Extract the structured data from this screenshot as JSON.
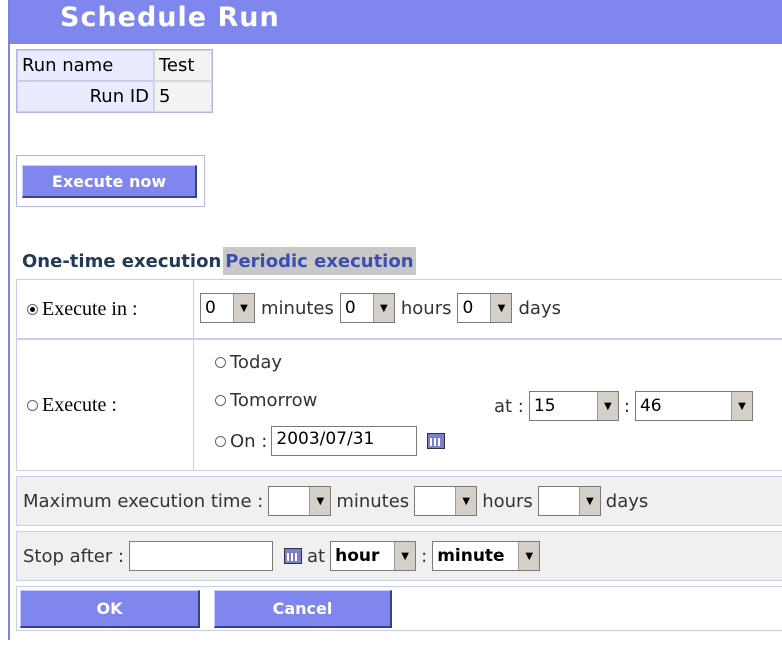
{
  "title": "Schedule Run",
  "run_info": [
    {
      "label": "Run name",
      "value": "Test"
    },
    {
      "label": "Run ID",
      "value": "5"
    }
  ],
  "execute_now_label": "Execute now",
  "tabs": [
    {
      "label": "One-time execution",
      "active": true
    },
    {
      "label": "Periodic execution",
      "active": false
    }
  ],
  "execute_in": {
    "label": "Execute in :",
    "minutes_value": "0",
    "minutes_label": "minutes",
    "hours_value": "0",
    "hours_label": "hours",
    "days_value": "0",
    "days_label": "days"
  },
  "execute_at": {
    "label": "Execute :",
    "today_label": "Today",
    "tomorrow_label": "Tomorrow",
    "on_label": "On :",
    "date_value": "2003/07/31",
    "at_label": "at :",
    "hour_value": "15",
    "colon": ":",
    "minute_value": "46"
  },
  "max_time": {
    "label": "Maximum execution time :",
    "minutes_label": "minutes",
    "hours_label": "hours",
    "days_label": "days"
  },
  "stop_after": {
    "label": "Stop after :",
    "at_label": "at",
    "hour_value": "hour",
    "colon": ":",
    "minute_value": "minute"
  },
  "ok_label": "OK",
  "cancel_label": "Cancel",
  "colors": {
    "accent": "#7f86ee"
  }
}
